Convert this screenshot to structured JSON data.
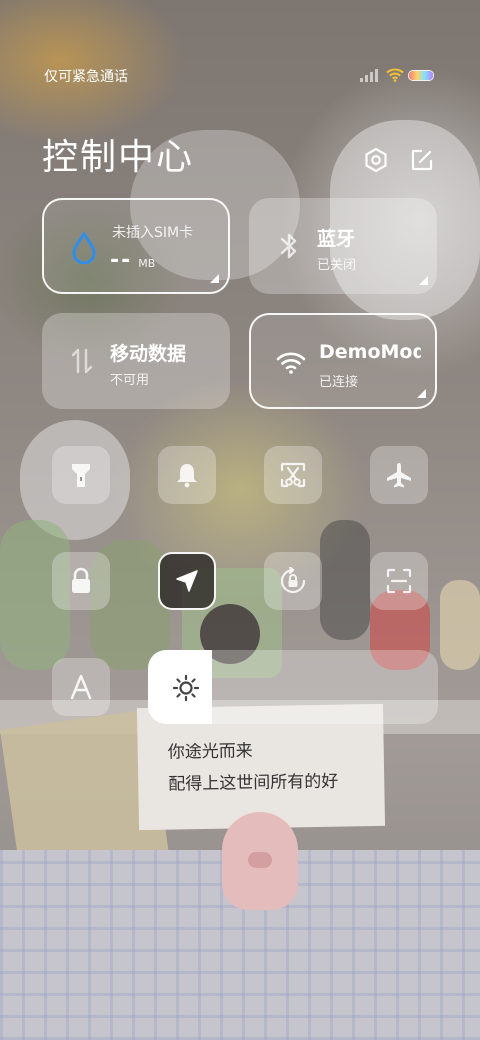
{
  "status_bar": {
    "carrier_text": "仅可紧急通话",
    "signal_icon": "signal-bars-icon",
    "wifi_icon": "wifi-icon",
    "battery_icon": "battery-icon"
  },
  "header": {
    "title": "控制中心",
    "settings_icon": "settings-hex-icon",
    "edit_icon": "edit-icon"
  },
  "tiles": {
    "data_usage": {
      "label": "未插入SIM卡",
      "value": "--",
      "unit": "MB",
      "icon": "water-drop-icon"
    },
    "bluetooth": {
      "title": "蓝牙",
      "status": "已关闭",
      "icon": "bluetooth-icon"
    },
    "mobile_data": {
      "title": "移动数据",
      "status": "不可用",
      "icon": "data-arrows-icon"
    },
    "wifi": {
      "title": "DemoMode",
      "status": "已连接",
      "icon": "wifi-icon"
    }
  },
  "quick_toggles": [
    {
      "name": "flashlight",
      "icon": "flashlight-icon",
      "active": false
    },
    {
      "name": "silent",
      "icon": "bell-icon",
      "active": false
    },
    {
      "name": "screenshot",
      "icon": "screenshot-scissors-icon",
      "active": false
    },
    {
      "name": "airplane-mode",
      "icon": "airplane-icon",
      "active": false
    },
    {
      "name": "lock-screen",
      "icon": "lock-icon",
      "active": false
    },
    {
      "name": "location",
      "icon": "location-arrow-icon",
      "active": true
    },
    {
      "name": "rotation-lock",
      "icon": "rotation-lock-icon",
      "active": false
    },
    {
      "name": "scanner",
      "icon": "scan-icon",
      "active": false
    },
    {
      "name": "reading-mode",
      "icon": "font-a-icon",
      "active": false
    }
  ],
  "brightness": {
    "level": 0.22,
    "icon": "sun-icon"
  },
  "colors": {
    "text": "#ffffff",
    "tile_bg": "rgba(255,255,255,0.28)",
    "data_icon": "#2f8ee8",
    "active_toggle_bg": "#2c2826"
  }
}
